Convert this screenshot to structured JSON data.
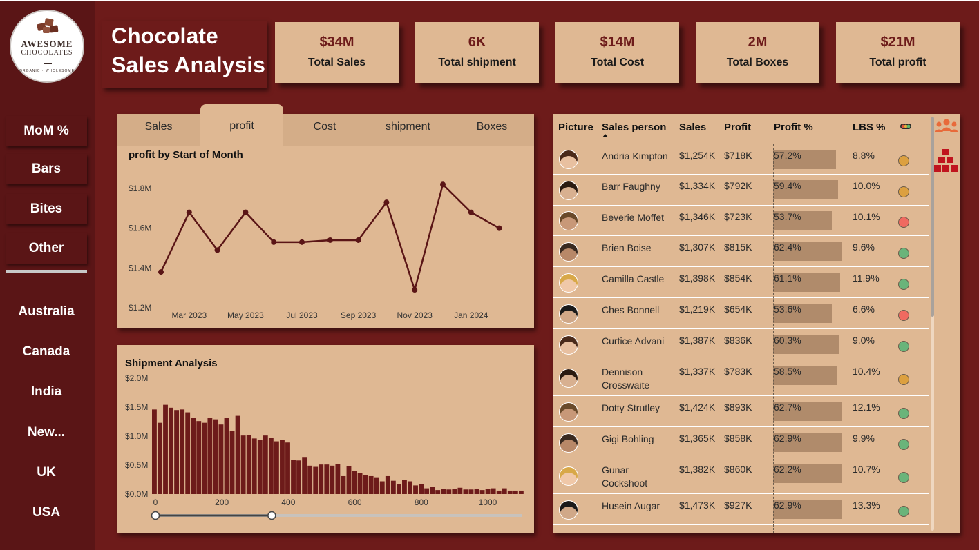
{
  "logo": {
    "line1": "AWESOME",
    "line2": "CHOCOLATES",
    "line3": "ORGANIC · WHOLESOME"
  },
  "title": {
    "line1": "Chocolate",
    "line2": "Sales Analysis"
  },
  "nav": {
    "items": [
      "MoM %",
      "Bars",
      "Bites",
      "Other"
    ]
  },
  "countries": [
    "Australia",
    "Canada",
    "India",
    "New...",
    "UK",
    "USA"
  ],
  "kpis": [
    {
      "value": "$34M",
      "label": "Total Sales"
    },
    {
      "value": "6K",
      "label": "Total shipment"
    },
    {
      "value": "$14M",
      "label": "Total Cost"
    },
    {
      "value": "2M",
      "label": "Total Boxes"
    },
    {
      "value": "$21M",
      "label": "Total profit"
    }
  ],
  "tabs": [
    "Sales",
    "profit",
    "Cost",
    "shipment",
    "Boxes"
  ],
  "active_tab": "profit",
  "colors": {
    "background": "#6d1b1a",
    "sidebar": "#5a1516",
    "card": "#dfb893",
    "accent": "#6d1b1a",
    "good": "#6ab47a",
    "medium": "#dca040",
    "bad": "#f06a60"
  },
  "chart_data": [
    {
      "type": "line",
      "title": "profit by Start of Month",
      "x": [
        "Feb 2023",
        "Mar 2023",
        "Apr 2023",
        "May 2023",
        "Jun 2023",
        "Jul 2023",
        "Aug 2023",
        "Sep 2023",
        "Oct 2023",
        "Nov 2023",
        "Dec 2023",
        "Jan 2024",
        "Feb 2024"
      ],
      "tick_labels": [
        "Mar 2023",
        "May 2023",
        "Jul 2023",
        "Sep 2023",
        "Nov 2023",
        "Jan 2024"
      ],
      "y": [
        1.38,
        1.68,
        1.49,
        1.68,
        1.53,
        1.53,
        1.54,
        1.54,
        1.73,
        1.29,
        1.82,
        1.68,
        1.6
      ],
      "unit": "M",
      "yticks": [
        "$1.2M",
        "$1.4M",
        "$1.6M",
        "$1.8M"
      ],
      "ylim": [
        1.2,
        1.85
      ],
      "grid": false
    },
    {
      "type": "bar",
      "title": "Shipment Analysis",
      "xticks": [
        "0",
        "200",
        "400",
        "600",
        "800",
        "1000"
      ],
      "yticks": [
        "$0.0M",
        "$0.5M",
        "$1.0M",
        "$1.5M",
        "$2.0M"
      ],
      "ylim": [
        0,
        2.0
      ],
      "x_range": [
        0,
        1100
      ],
      "values": [
        1.46,
        1.23,
        1.54,
        1.49,
        1.45,
        1.46,
        1.41,
        1.31,
        1.26,
        1.23,
        1.31,
        1.29,
        1.2,
        1.32,
        1.09,
        1.35,
        1.01,
        1.02,
        0.96,
        0.93,
        1.01,
        0.97,
        0.91,
        0.94,
        0.89,
        0.59,
        0.58,
        0.64,
        0.49,
        0.47,
        0.51,
        0.51,
        0.49,
        0.52,
        0.31,
        0.48,
        0.4,
        0.36,
        0.33,
        0.31,
        0.29,
        0.22,
        0.31,
        0.23,
        0.17,
        0.25,
        0.22,
        0.15,
        0.17,
        0.1,
        0.12,
        0.07,
        0.09,
        0.08,
        0.09,
        0.11,
        0.08,
        0.08,
        0.09,
        0.07,
        0.09,
        0.1,
        0.06,
        0.1,
        0.06,
        0.06,
        0.06
      ],
      "slider": {
        "low": 0,
        "high": 350
      }
    }
  ],
  "table": {
    "headers": [
      "Picture",
      "Sales person",
      "Sales",
      "Profit",
      "Profit %",
      "LBS %"
    ],
    "rows": [
      {
        "name": "Andria Kimpton",
        "sales": "$1,254K",
        "profit": "$718K",
        "pct": "57.2%",
        "pct_value": 57.2,
        "lbs": "8.8%",
        "status": "medium"
      },
      {
        "name": "Barr Faughny",
        "sales": "$1,334K",
        "profit": "$792K",
        "pct": "59.4%",
        "pct_value": 59.4,
        "lbs": "10.0%",
        "status": "medium"
      },
      {
        "name": "Beverie Moffet",
        "sales": "$1,346K",
        "profit": "$723K",
        "pct": "53.7%",
        "pct_value": 53.7,
        "lbs": "10.1%",
        "status": "bad"
      },
      {
        "name": "Brien Boise",
        "sales": "$1,307K",
        "profit": "$815K",
        "pct": "62.4%",
        "pct_value": 62.4,
        "lbs": "9.6%",
        "status": "good"
      },
      {
        "name": "Camilla Castle",
        "sales": "$1,398K",
        "profit": "$854K",
        "pct": "61.1%",
        "pct_value": 61.1,
        "lbs": "11.9%",
        "status": "good"
      },
      {
        "name": "Ches Bonnell",
        "sales": "$1,219K",
        "profit": "$654K",
        "pct": "53.6%",
        "pct_value": 53.6,
        "lbs": "6.6%",
        "status": "bad"
      },
      {
        "name": "Curtice Advani",
        "sales": "$1,387K",
        "profit": "$836K",
        "pct": "60.3%",
        "pct_value": 60.3,
        "lbs": "9.0%",
        "status": "good"
      },
      {
        "name": "Dennison Crosswaite",
        "sales": "$1,337K",
        "profit": "$783K",
        "pct": "58.5%",
        "pct_value": 58.5,
        "lbs": "10.4%",
        "status": "medium"
      },
      {
        "name": "Dotty Strutley",
        "sales": "$1,424K",
        "profit": "$893K",
        "pct": "62.7%",
        "pct_value": 62.7,
        "lbs": "12.1%",
        "status": "good"
      },
      {
        "name": "Gigi Bohling",
        "sales": "$1,365K",
        "profit": "$858K",
        "pct": "62.9%",
        "pct_value": 62.9,
        "lbs": "9.9%",
        "status": "good"
      },
      {
        "name": "Gunar Cockshoot",
        "sales": "$1,382K",
        "profit": "$860K",
        "pct": "62.2%",
        "pct_value": 62.2,
        "lbs": "10.7%",
        "status": "good"
      },
      {
        "name": "Husein Augar",
        "sales": "$1,473K",
        "profit": "$927K",
        "pct": "62.9%",
        "pct_value": 62.9,
        "lbs": "13.3%",
        "status": "good"
      }
    ]
  },
  "icons": {
    "team": "people-icon",
    "boxes": "boxes-icon",
    "indicator": "traffic-light-icon"
  }
}
